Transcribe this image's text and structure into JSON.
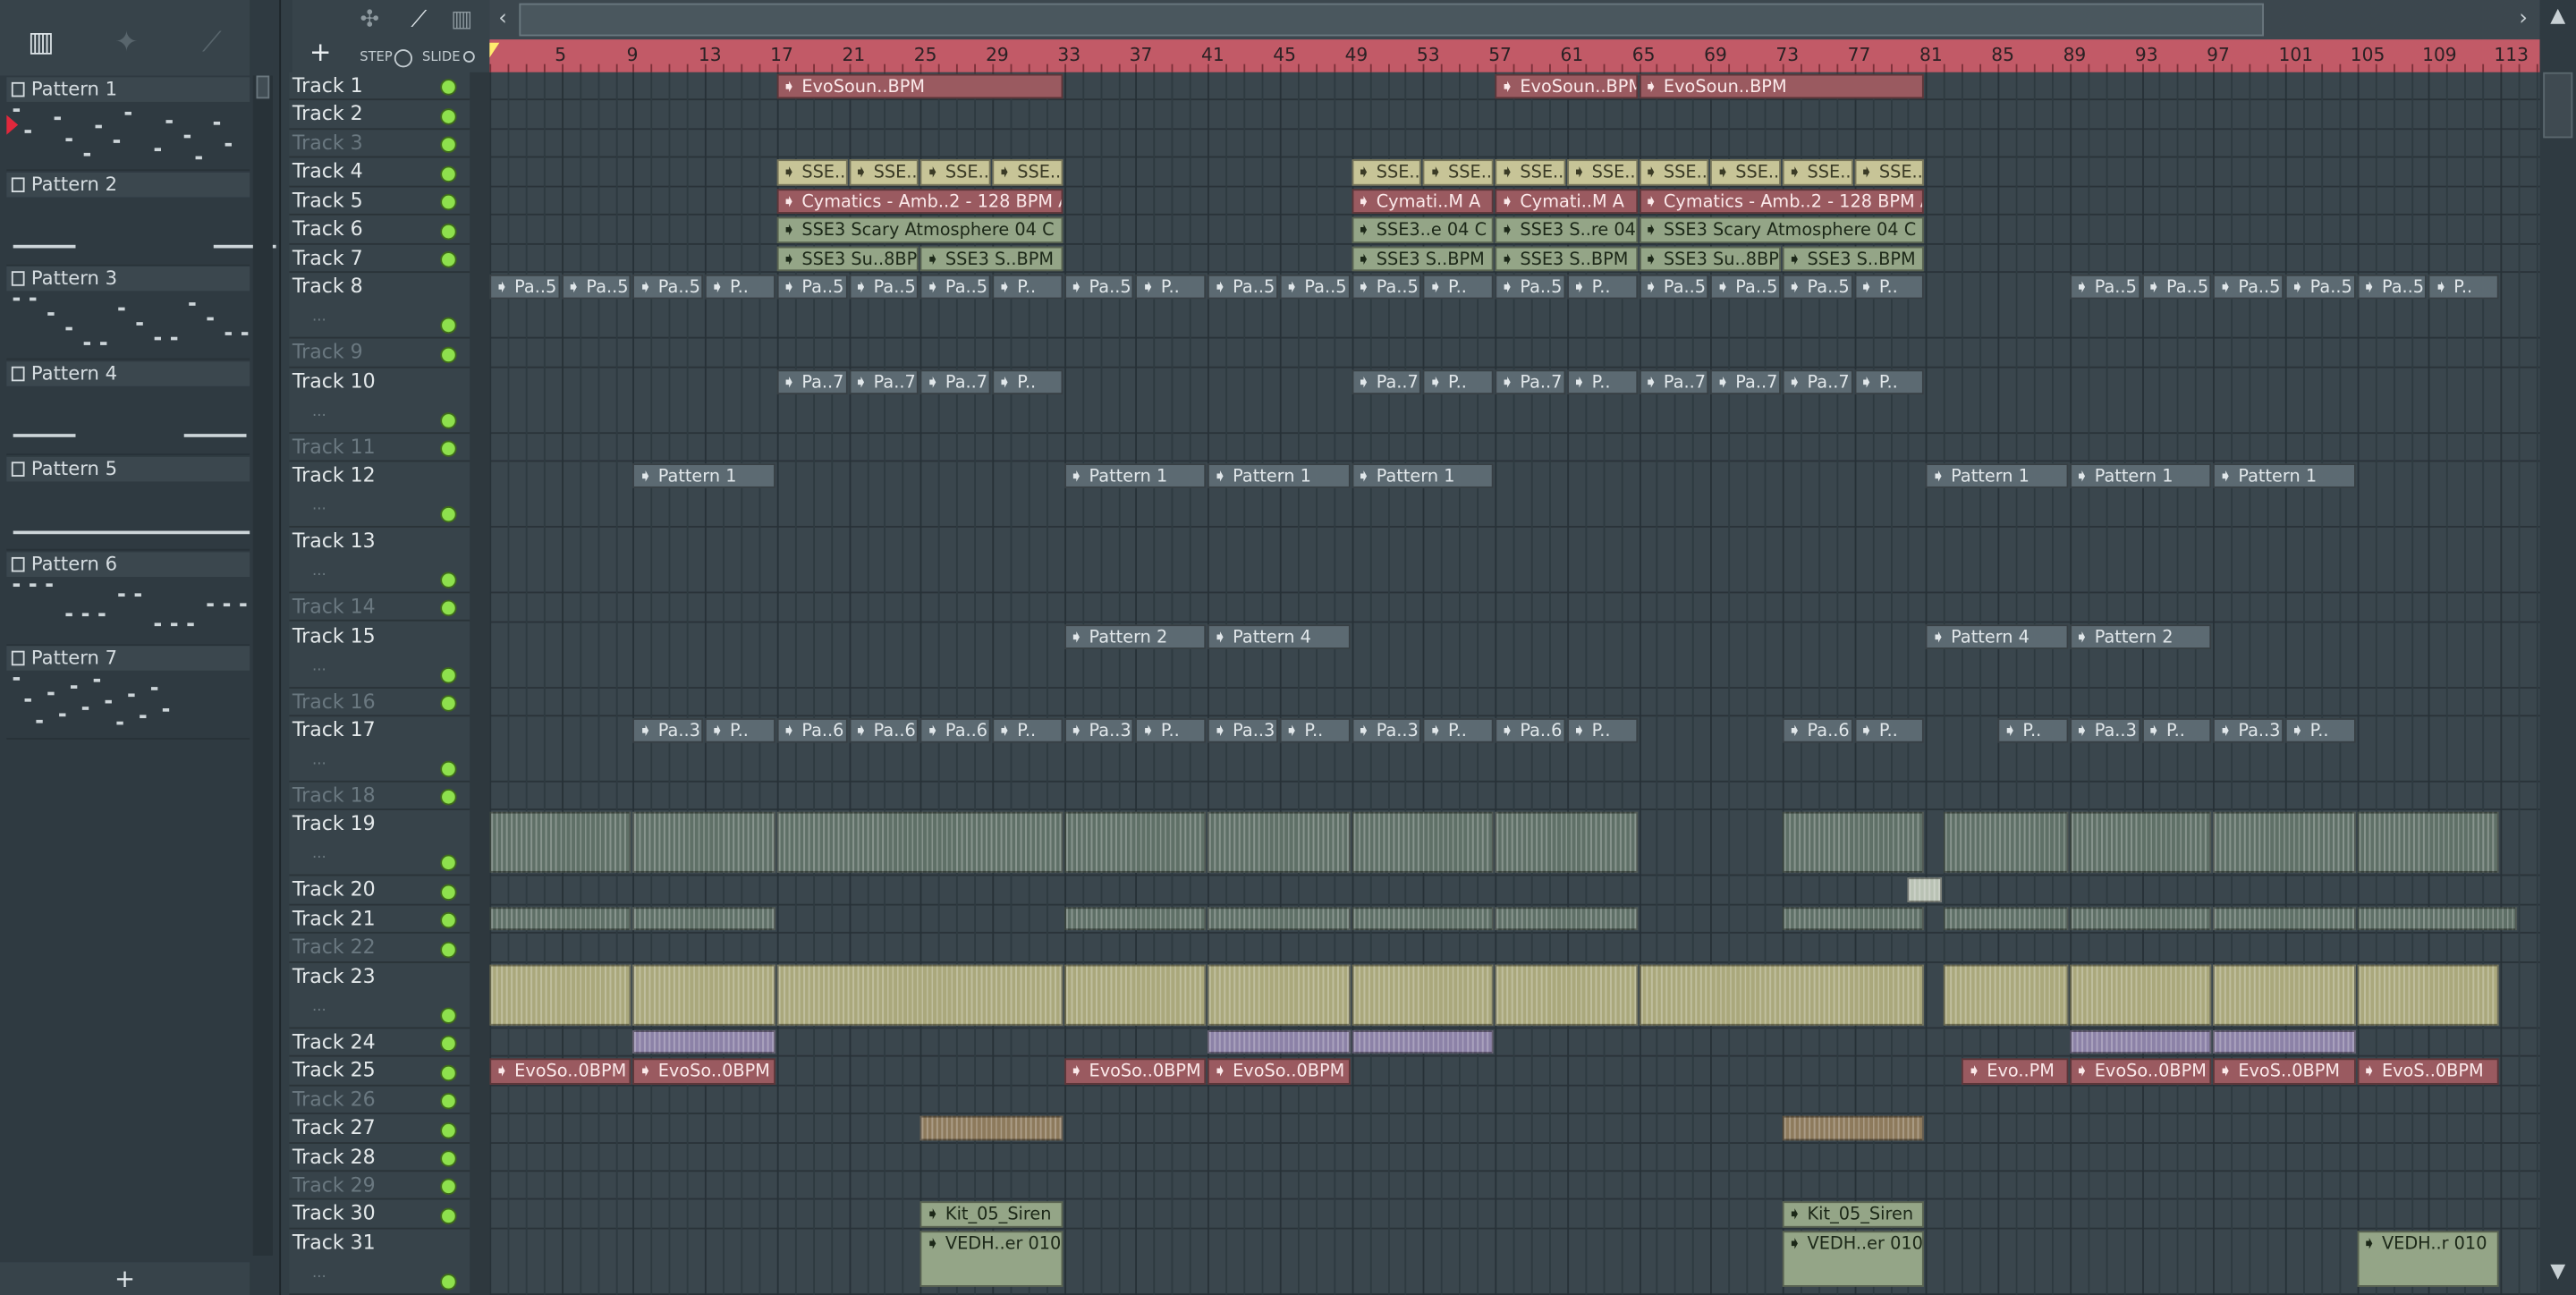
{
  "picker": {
    "patterns": [
      "Pattern 1",
      "Pattern 2",
      "Pattern 3",
      "Pattern 4",
      "Pattern 5",
      "Pattern 6",
      "Pattern 7"
    ],
    "add_label": "+"
  },
  "toolbar": {
    "add_label": "+",
    "step_label": "STEP",
    "slide_label": "SLIDE"
  },
  "ruler": {
    "bars": [
      "5",
      "9",
      "13",
      "17",
      "21",
      "25",
      "29",
      "33",
      "37",
      "41",
      "45",
      "49",
      "53",
      "57",
      "61",
      "65",
      "69",
      "73",
      "77",
      "81",
      "85",
      "89",
      "93",
      "97",
      "101",
      "105",
      "109",
      "113"
    ]
  },
  "tracks": [
    {
      "name": "Track 1",
      "muted": false,
      "tall": false
    },
    {
      "name": "Track 2",
      "muted": false,
      "tall": false
    },
    {
      "name": "Track 3",
      "muted": true,
      "tall": false
    },
    {
      "name": "Track 4",
      "muted": false,
      "tall": false
    },
    {
      "name": "Track 5",
      "muted": false,
      "tall": false
    },
    {
      "name": "Track 6",
      "muted": false,
      "tall": false
    },
    {
      "name": "Track 7",
      "muted": false,
      "tall": false
    },
    {
      "name": "Track 8",
      "muted": false,
      "tall": true
    },
    {
      "name": "Track 9",
      "muted": true,
      "tall": false
    },
    {
      "name": "Track 10",
      "muted": false,
      "tall": true
    },
    {
      "name": "Track 11",
      "muted": true,
      "tall": false
    },
    {
      "name": "Track 12",
      "muted": false,
      "tall": true
    },
    {
      "name": "Track 13",
      "muted": false,
      "tall": true
    },
    {
      "name": "Track 14",
      "muted": true,
      "tall": false
    },
    {
      "name": "Track 15",
      "muted": false,
      "tall": true
    },
    {
      "name": "Track 16",
      "muted": true,
      "tall": false
    },
    {
      "name": "Track 17",
      "muted": false,
      "tall": true
    },
    {
      "name": "Track 18",
      "muted": true,
      "tall": false
    },
    {
      "name": "Track 19",
      "muted": false,
      "tall": true
    },
    {
      "name": "Track 20",
      "muted": false,
      "tall": false
    },
    {
      "name": "Track 21",
      "muted": false,
      "tall": false
    },
    {
      "name": "Track 22",
      "muted": true,
      "tall": false
    },
    {
      "name": "Track 23",
      "muted": false,
      "tall": true
    },
    {
      "name": "Track 24",
      "muted": false,
      "tall": false
    },
    {
      "name": "Track 25",
      "muted": false,
      "tall": false
    },
    {
      "name": "Track 26",
      "muted": true,
      "tall": false
    },
    {
      "name": "Track 27",
      "muted": false,
      "tall": false
    },
    {
      "name": "Track 28",
      "muted": false,
      "tall": false
    },
    {
      "name": "Track 29",
      "muted": true,
      "tall": false
    },
    {
      "name": "Track 30",
      "muted": false,
      "tall": false
    },
    {
      "name": "Track 31",
      "muted": false,
      "tall": true
    }
  ],
  "track_more": "...",
  "clips": [
    {
      "track": 0,
      "start": 17,
      "len": 16,
      "label": "EvoSoun..BPM",
      "color": "audio"
    },
    {
      "track": 0,
      "start": 57,
      "len": 8,
      "label": "EvoSoun..BPM",
      "color": "audio"
    },
    {
      "track": 0,
      "start": 65,
      "len": 16,
      "label": "EvoSoun..BPM",
      "color": "audio"
    },
    {
      "track": 3,
      "start": 17,
      "len": 4,
      "label": "SSE..)",
      "color": "yellow"
    },
    {
      "track": 3,
      "start": 21,
      "len": 4,
      "label": "SSE..)",
      "color": "yellow"
    },
    {
      "track": 3,
      "start": 25,
      "len": 4,
      "label": "SSE..)",
      "color": "yellow"
    },
    {
      "track": 3,
      "start": 29,
      "len": 4,
      "label": "SSE..)",
      "color": "yellow"
    },
    {
      "track": 3,
      "start": 49,
      "len": 4,
      "label": "SSE..)",
      "color": "yellow"
    },
    {
      "track": 3,
      "start": 53,
      "len": 4,
      "label": "SSE..)",
      "color": "yellow"
    },
    {
      "track": 3,
      "start": 57,
      "len": 4,
      "label": "SSE..)",
      "color": "yellow"
    },
    {
      "track": 3,
      "start": 61,
      "len": 4,
      "label": "SSE..)",
      "color": "yellow"
    },
    {
      "track": 3,
      "start": 65,
      "len": 4,
      "label": "SSE..)",
      "color": "yellow"
    },
    {
      "track": 3,
      "start": 69,
      "len": 4,
      "label": "SSE..)",
      "color": "yellow"
    },
    {
      "track": 3,
      "start": 73,
      "len": 4,
      "label": "SSE..)",
      "color": "yellow"
    },
    {
      "track": 3,
      "start": 77,
      "len": 4,
      "label": "SSE..)",
      "color": "yellow"
    },
    {
      "track": 4,
      "start": 17,
      "len": 16,
      "label": "Cymatics - Amb..2 - 128 BPM A",
      "color": "audio"
    },
    {
      "track": 4,
      "start": 49,
      "len": 8,
      "label": "Cymati..M A",
      "color": "audio"
    },
    {
      "track": 4,
      "start": 57,
      "len": 8,
      "label": "Cymati..M A",
      "color": "audio"
    },
    {
      "track": 4,
      "start": 65,
      "len": 16,
      "label": "Cymatics - Amb..2 - 128 BPM A",
      "color": "audio"
    },
    {
      "track": 5,
      "start": 17,
      "len": 16,
      "label": "SSE3 Scary Atmosphere 04 C",
      "color": "green"
    },
    {
      "track": 5,
      "start": 49,
      "len": 8,
      "label": "SSE3..e 04 C",
      "color": "green"
    },
    {
      "track": 5,
      "start": 57,
      "len": 8,
      "label": "SSE3 S..re 04 C",
      "color": "green"
    },
    {
      "track": 5,
      "start": 65,
      "len": 16,
      "label": "SSE3 Scary Atmosphere 04 C",
      "color": "green"
    },
    {
      "track": 6,
      "start": 17,
      "len": 8,
      "label": "SSE3 Su..8BPM",
      "color": "green"
    },
    {
      "track": 6,
      "start": 25,
      "len": 8,
      "label": "SSE3 S..BPM",
      "color": "green"
    },
    {
      "track": 6,
      "start": 49,
      "len": 8,
      "label": "SSE3 S..BPM",
      "color": "green"
    },
    {
      "track": 6,
      "start": 57,
      "len": 8,
      "label": "SSE3 S..BPM",
      "color": "green"
    },
    {
      "track": 6,
      "start": 65,
      "len": 8,
      "label": "SSE3 Su..8BPM",
      "color": "green"
    },
    {
      "track": 6,
      "start": 73,
      "len": 8,
      "label": "SSE3 S..BPM",
      "color": "green"
    },
    {
      "track": 11,
      "start": 9,
      "len": 8,
      "label": "Pattern 1",
      "color": "pat"
    },
    {
      "track": 11,
      "start": 33,
      "len": 8,
      "label": "Pattern 1",
      "color": "pat"
    },
    {
      "track": 11,
      "start": 41,
      "len": 8,
      "label": "Pattern 1",
      "color": "pat"
    },
    {
      "track": 11,
      "start": 49,
      "len": 8,
      "label": "Pattern 1",
      "color": "pat"
    },
    {
      "track": 11,
      "start": 81,
      "len": 8,
      "label": "Pattern 1",
      "color": "pat"
    },
    {
      "track": 11,
      "start": 89,
      "len": 8,
      "label": "Pattern 1",
      "color": "pat"
    },
    {
      "track": 11,
      "start": 97,
      "len": 8,
      "label": "Pattern 1",
      "color": "pat"
    },
    {
      "track": 14,
      "start": 33,
      "len": 8,
      "label": "Pattern 2",
      "color": "pat"
    },
    {
      "track": 14,
      "start": 41,
      "len": 8,
      "label": "Pattern 4",
      "color": "pat"
    },
    {
      "track": 14,
      "start": 81,
      "len": 8,
      "label": "Pattern 4",
      "color": "pat"
    },
    {
      "track": 14,
      "start": 89,
      "len": 8,
      "label": "Pattern 2",
      "color": "pat"
    },
    {
      "track": 24,
      "start": 1,
      "len": 8,
      "label": "EvoSo..0BPM",
      "color": "audio"
    },
    {
      "track": 24,
      "start": 9,
      "len": 8,
      "label": "EvoSo..0BPM",
      "color": "audio"
    },
    {
      "track": 24,
      "start": 33,
      "len": 8,
      "label": "EvoSo..0BPM",
      "color": "audio"
    },
    {
      "track": 24,
      "start": 41,
      "len": 8,
      "label": "EvoSo..0BPM",
      "color": "audio"
    },
    {
      "track": 24,
      "start": 83,
      "len": 6,
      "label": "Evo..PM",
      "color": "audio"
    },
    {
      "track": 24,
      "start": 89,
      "len": 8,
      "label": "EvoSo..0BPM",
      "color": "audio"
    },
    {
      "track": 24,
      "start": 97,
      "len": 8,
      "label": "EvoS..0BPM",
      "color": "audio"
    },
    {
      "track": 24,
      "start": 105,
      "len": 8,
      "label": "EvoS..0BPM",
      "color": "audio"
    },
    {
      "track": 29,
      "start": 25,
      "len": 8,
      "label": "Kit_05_Siren",
      "color": "green"
    },
    {
      "track": 29,
      "start": 73,
      "len": 8,
      "label": "Kit_05_Siren",
      "color": "green"
    },
    {
      "track": 30,
      "start": 25,
      "len": 8,
      "label": "VEDH..er 010",
      "color": "green"
    },
    {
      "track": 30,
      "start": 73,
      "len": 8,
      "label": "VEDH..er 010",
      "color": "green"
    },
    {
      "track": 30,
      "start": 105,
      "len": 8,
      "label": "VEDH..r 010",
      "color": "green"
    }
  ],
  "short_pattern_clips": [
    {
      "track": 7,
      "label": "Pa..5",
      "starts": [
        1,
        5,
        9,
        17,
        21,
        25,
        33,
        41,
        45,
        49,
        57,
        65,
        69,
        73,
        89,
        93,
        97,
        101,
        105
      ],
      "len": 4
    },
    {
      "track": 7,
      "label": "P..",
      "starts": [
        13,
        29,
        37,
        53,
        61,
        77,
        109
      ],
      "len": 4
    },
    {
      "track": 9,
      "label": "Pa..7",
      "starts": [
        17,
        21,
        25,
        49,
        57,
        65,
        69,
        73
      ],
      "len": 4
    },
    {
      "track": 9,
      "label": "P..",
      "starts": [
        29,
        53,
        61,
        77
      ],
      "len": 4
    },
    {
      "track": 16,
      "label": "Pa..3",
      "starts": [
        9,
        33,
        41,
        49,
        89,
        97
      ],
      "len": 4
    },
    {
      "track": 16,
      "label": "Pa..6",
      "starts": [
        17,
        21,
        25,
        57,
        73
      ],
      "len": 4
    },
    {
      "track": 16,
      "label": "P..",
      "starts": [
        13,
        29,
        37,
        45,
        53,
        61,
        77,
        85,
        93,
        101
      ],
      "len": 4
    }
  ],
  "block_clips": [
    {
      "track": 18,
      "color": "wave",
      "ranges": [
        [
          1,
          8
        ],
        [
          9,
          16
        ],
        [
          17,
          32
        ],
        [
          33,
          40
        ],
        [
          41,
          48
        ],
        [
          49,
          56
        ],
        [
          57,
          64
        ],
        [
          73,
          80
        ],
        [
          82,
          88
        ],
        [
          89,
          96
        ],
        [
          97,
          104
        ],
        [
          105,
          112
        ]
      ]
    },
    {
      "track": 20,
      "color": "wave",
      "ranges": [
        [
          1,
          8
        ],
        [
          9,
          16
        ],
        [
          33,
          40
        ],
        [
          41,
          48
        ],
        [
          49,
          56
        ],
        [
          57,
          64
        ],
        [
          73,
          80
        ],
        [
          82,
          88
        ],
        [
          89,
          96
        ],
        [
          97,
          104
        ],
        [
          105,
          113
        ]
      ]
    },
    {
      "track": 22,
      "color": "olive",
      "ranges": [
        [
          1,
          8
        ],
        [
          9,
          16
        ],
        [
          17,
          32
        ],
        [
          33,
          40
        ],
        [
          41,
          48
        ],
        [
          49,
          56
        ],
        [
          57,
          64
        ],
        [
          65,
          80
        ],
        [
          82,
          88
        ],
        [
          89,
          96
        ],
        [
          97,
          104
        ],
        [
          105,
          112
        ]
      ]
    },
    {
      "track": 23,
      "color": "purple",
      "ranges": [
        [
          9,
          16
        ],
        [
          41,
          48
        ],
        [
          49,
          56
        ],
        [
          89,
          96
        ],
        [
          97,
          104
        ]
      ]
    },
    {
      "track": 26,
      "color": "brown",
      "ranges": [
        [
          25,
          32
        ],
        [
          73,
          80
        ]
      ]
    },
    {
      "track": 19,
      "color": "bright",
      "ranges": [
        [
          80,
          81
        ]
      ]
    }
  ]
}
